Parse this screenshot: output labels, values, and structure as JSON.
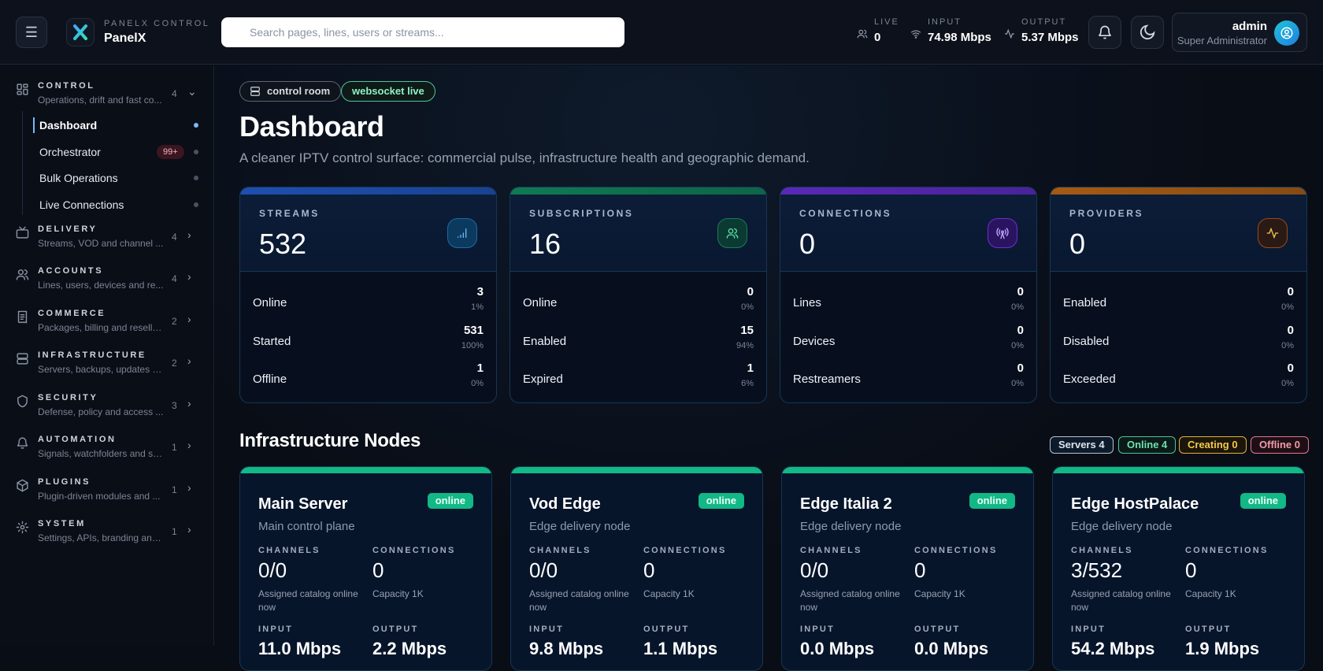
{
  "header": {
    "brand_sub": "PANELX CONTROL",
    "brand_name": "PanelX",
    "search_placeholder": "Search pages, lines, users or streams...",
    "stats": [
      {
        "label": "LIVE",
        "value": "0",
        "icon": "users-icon"
      },
      {
        "label": "INPUT",
        "value": "74.98 Mbps",
        "icon": "wifi-icon"
      },
      {
        "label": "OUTPUT",
        "value": "5.37 Mbps",
        "icon": "activity-icon"
      }
    ],
    "user": {
      "name": "admin",
      "role": "Super Administrator"
    }
  },
  "sidebar": {
    "groups": [
      {
        "title": "CONTROL",
        "desc": "Operations, drift and fast co...",
        "count": "4",
        "icon": "grid-icon",
        "expanded": true
      },
      {
        "title": "DELIVERY",
        "desc": "Streams, VOD and channel ...",
        "count": "4",
        "icon": "tv-icon"
      },
      {
        "title": "ACCOUNTS",
        "desc": "Lines, users, devices and re...",
        "count": "4",
        "icon": "users-icon"
      },
      {
        "title": "COMMERCE",
        "desc": "Packages, billing and reselle...",
        "count": "2",
        "icon": "receipt-icon"
      },
      {
        "title": "INFRASTRUCTURE",
        "desc": "Servers, backups, updates a...",
        "count": "2",
        "icon": "server-icon"
      },
      {
        "title": "SECURITY",
        "desc": "Defense, policy and access ...",
        "count": "3",
        "icon": "shield-icon"
      },
      {
        "title": "AUTOMATION",
        "desc": "Signals, watchfolders and sc...",
        "count": "1",
        "icon": "bell-icon"
      },
      {
        "title": "PLUGINS",
        "desc": "Plugin-driven modules and ...",
        "count": "1",
        "icon": "package-icon"
      },
      {
        "title": "SYSTEM",
        "desc": "Settings, APIs, branding and...",
        "count": "1",
        "icon": "gear-icon"
      }
    ],
    "control_items": [
      {
        "label": "Dashboard",
        "active": true
      },
      {
        "label": "Orchestrator",
        "badge": "99+"
      },
      {
        "label": "Bulk Operations"
      },
      {
        "label": "Live Connections"
      }
    ]
  },
  "main": {
    "chips": [
      "control room",
      "websocket live"
    ],
    "title": "Dashboard",
    "subtitle": "A cleaner IPTV control surface: commercial pulse, infrastructure health and geographic demand.",
    "cards": [
      {
        "title": "STREAMS",
        "value": "532",
        "accent": "#1e4fb0",
        "icon": "signal-icon",
        "rows": [
          {
            "label": "Online",
            "value": "3",
            "pct": "1%"
          },
          {
            "label": "Started",
            "value": "531",
            "pct": "100%"
          },
          {
            "label": "Offline",
            "value": "1",
            "pct": "0%"
          }
        ]
      },
      {
        "title": "SUBSCRIPTIONS",
        "value": "16",
        "accent": "#0f7a52",
        "icon": "users-icon",
        "rows": [
          {
            "label": "Online",
            "value": "0",
            "pct": "0%"
          },
          {
            "label": "Enabled",
            "value": "15",
            "pct": "94%"
          },
          {
            "label": "Expired",
            "value": "1",
            "pct": "6%"
          }
        ]
      },
      {
        "title": "CONNECTIONS",
        "value": "0",
        "accent": "#5a28b8",
        "icon": "broadcast-icon",
        "rows": [
          {
            "label": "Lines",
            "value": "0",
            "pct": "0%"
          },
          {
            "label": "Devices",
            "value": "0",
            "pct": "0%"
          },
          {
            "label": "Restreamers",
            "value": "0",
            "pct": "0%"
          }
        ]
      },
      {
        "title": "PROVIDERS",
        "value": "0",
        "accent": "#a55a12",
        "icon": "activity-icon",
        "rows": [
          {
            "label": "Enabled",
            "value": "0",
            "pct": "0%"
          },
          {
            "label": "Disabled",
            "value": "0",
            "pct": "0%"
          },
          {
            "label": "Exceeded",
            "value": "0",
            "pct": "0%"
          }
        ]
      }
    ],
    "nodes_title": "Infrastructure Nodes",
    "pills": [
      "Servers 4",
      "Online 4",
      "Creating 0",
      "Offline 0"
    ],
    "labels": {
      "channels": "CHANNELS",
      "connections": "CONNECTIONS",
      "input": "INPUT",
      "output": "OUTPUT",
      "assigned": "Assigned catalog online now"
    },
    "nodes": [
      {
        "name": "Main Server",
        "status": "online",
        "desc": "Main control plane",
        "channels": "0/0",
        "connections": "0",
        "capacity": "Capacity 1K",
        "input": "11.0 Mbps",
        "output": "2.2 Mbps"
      },
      {
        "name": "Vod Edge",
        "status": "online",
        "desc": "Edge delivery node",
        "channels": "0/0",
        "connections": "0",
        "capacity": "Capacity 1K",
        "input": "9.8 Mbps",
        "output": "1.1 Mbps"
      },
      {
        "name": "Edge Italia 2",
        "status": "online",
        "desc": "Edge delivery node",
        "channels": "0/0",
        "connections": "0",
        "capacity": "Capacity 1K",
        "input": "0.0 Mbps",
        "output": "0.0 Mbps"
      },
      {
        "name": "Edge HostPalace",
        "status": "online",
        "desc": "Edge delivery node",
        "channels": "3/532",
        "connections": "0",
        "capacity": "Capacity 1K",
        "input": "54.2 Mbps",
        "output": "1.9 Mbps"
      }
    ]
  }
}
